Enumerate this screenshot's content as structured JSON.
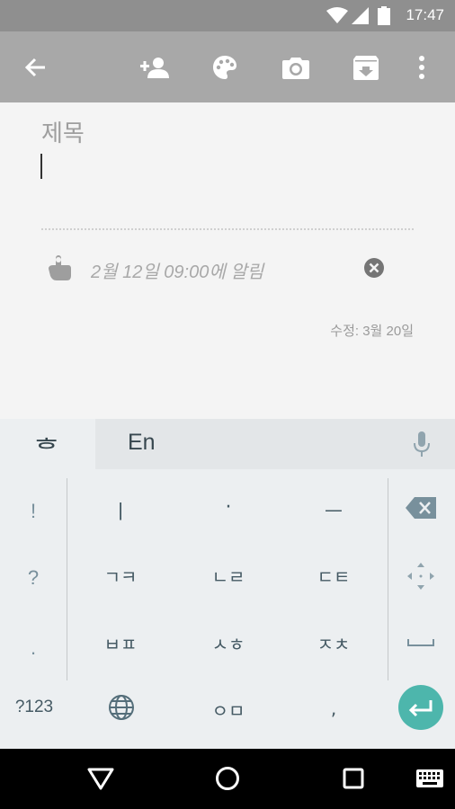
{
  "status_bar": {
    "time": "17:47"
  },
  "toolbar": {
    "back": "back-arrow-icon",
    "icons": [
      "add-person-icon",
      "palette-icon",
      "camera-icon",
      "archive-icon",
      "more-vert-icon"
    ]
  },
  "note": {
    "title_placeholder": "제목",
    "reminder_text": "2월 12일 09:00에 알림",
    "edited_text": "수정: 3월 20일"
  },
  "keyboard": {
    "lang_icon_label": "ᄒ",
    "suggestion": "En",
    "left_keys": [
      "!",
      "?",
      "."
    ],
    "rows": [
      [
        "ㅣ",
        "·",
        "ㅡ"
      ],
      [
        "ㄱㅋ",
        "ㄴㄹ",
        "ㄷㅌ"
      ],
      [
        "ㅂㅍ",
        "ㅅㅎ",
        "ㅈㅊ"
      ]
    ],
    "bottom": {
      "symbols": "?123",
      "center": "ㅇㅁ",
      "comma": ","
    },
    "colors": {
      "enter_bg": "#4db6ac"
    }
  },
  "colors": {
    "toolbar": "#a8a8a8",
    "status": "#8f8f8f"
  }
}
